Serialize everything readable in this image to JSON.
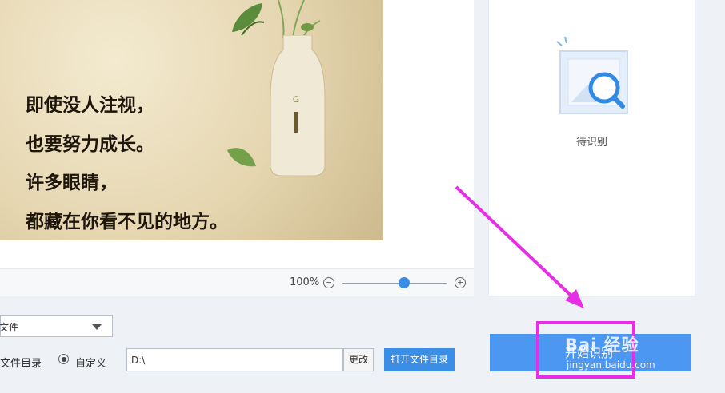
{
  "preview": {
    "quote_lines": [
      "即使没人注视，",
      "也要努力成长。",
      "许多眼睛，",
      "都藏在你看不见的地方。"
    ],
    "zoom": {
      "value_label": "100%",
      "minus": "⊖",
      "plus": "⊕"
    }
  },
  "result_panel": {
    "status": "待识别"
  },
  "options": {
    "format_value": "文件",
    "output_dir_label": "文件目录",
    "custom_label": "自定义",
    "path_value": "D:\\",
    "change_label": "更改",
    "open_dir_label": "打开文件目录"
  },
  "actions": {
    "start_label": "开始识别"
  },
  "watermark": {
    "logo": "Bai 经验",
    "url": "jingyan.baidu.com"
  },
  "colors": {
    "accent": "#3a8ee6",
    "annotation": "#e62ee6"
  }
}
